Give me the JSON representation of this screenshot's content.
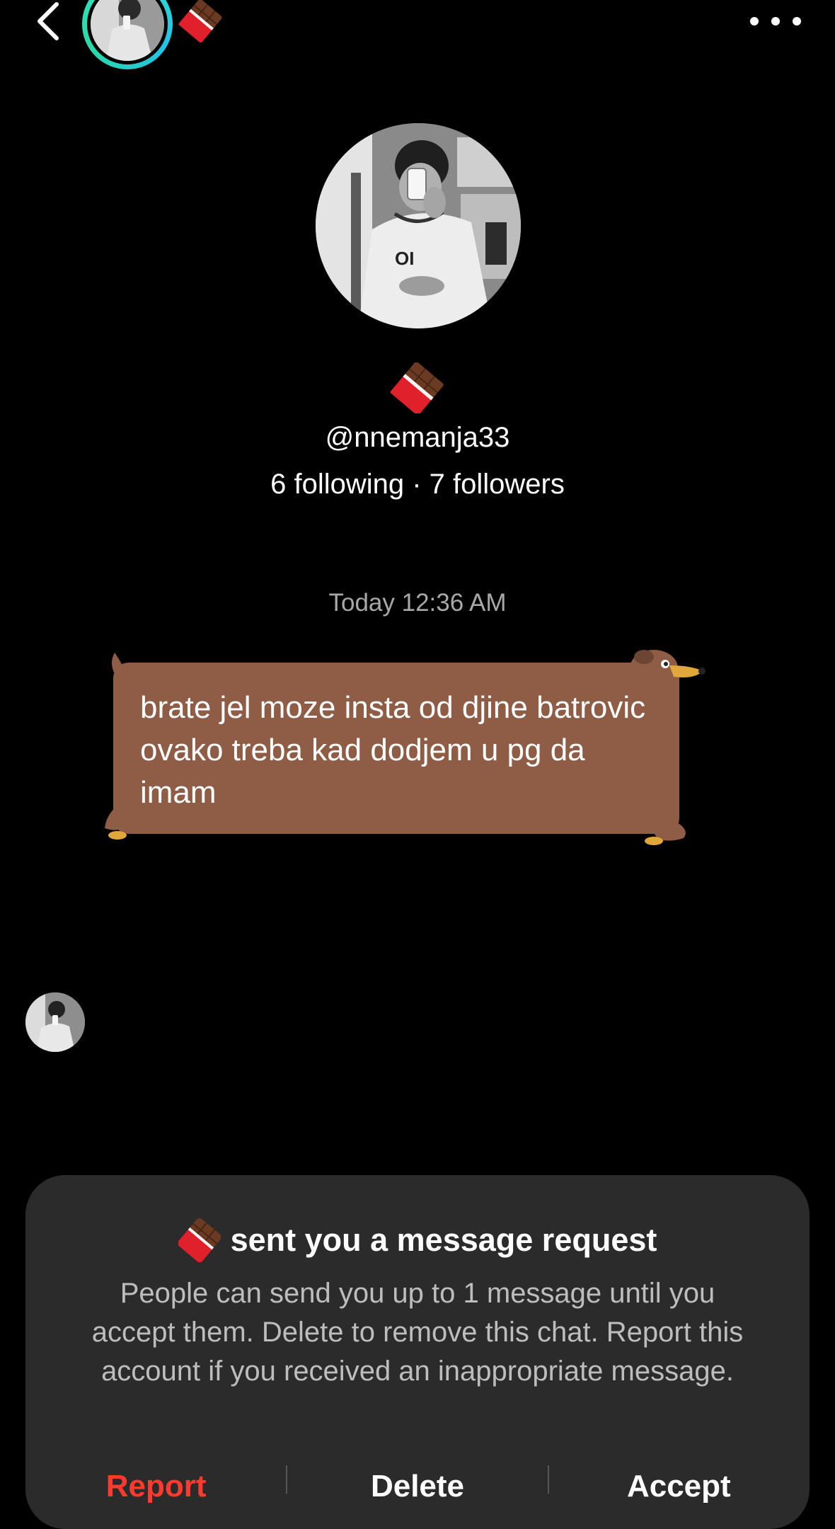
{
  "header": {
    "back_icon": "chevron-left-icon",
    "more_icon": "more-horizontal-icon",
    "emoji": "chocolate-bar"
  },
  "profile": {
    "emoji": "chocolate-bar",
    "username": "@nnemanja33",
    "stats": "6 following · 7 followers"
  },
  "conversation": {
    "timestamp": "Today 12:36 AM",
    "messages": [
      {
        "text": "brate jel moze insta od djine batrovic ovako treba kad dodjem u pg da imam",
        "bubble_style": "dachshund",
        "bubble_color": "#8f5c45"
      }
    ]
  },
  "request_sheet": {
    "title": "sent you a message request",
    "description": "People can send you up to 1 message until you accept them. Delete to remove this chat. Report this account if you received an inappropriate message.",
    "actions": {
      "report": "Report",
      "delete": "Delete",
      "accept": "Accept"
    },
    "report_color": "#ff3b30"
  },
  "colors": {
    "background": "#000000",
    "sheet": "#2b2b2b",
    "story_ring": "#2ee6c8"
  }
}
